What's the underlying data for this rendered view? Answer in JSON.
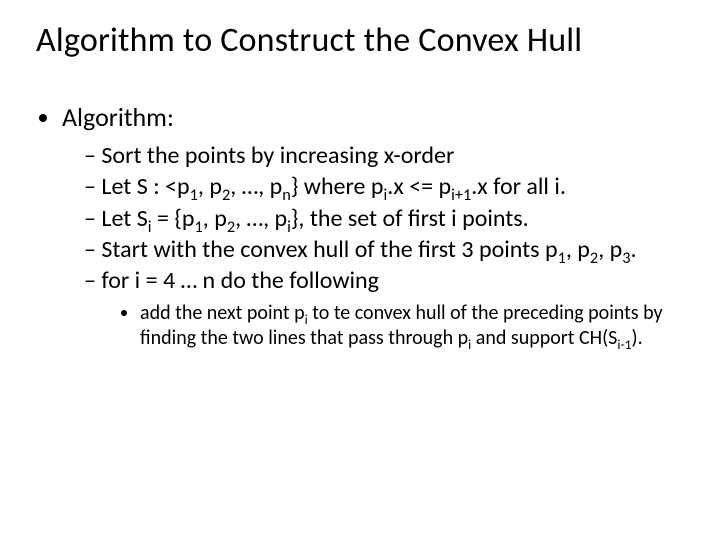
{
  "title": "Algorithm to Construct the Convex Hull",
  "bullets": {
    "lvl1": "Algorithm:",
    "lvl2": [
      {
        "parts": [
          "Sort the points by increasing x-order"
        ]
      },
      {
        "parts": [
          "Let S : <p",
          {
            "sub": "1"
          },
          ", p",
          {
            "sub": "2"
          },
          ", …, p",
          {
            "sub": "n"
          },
          "} where p",
          {
            "sub": "i"
          },
          ".x <= p",
          {
            "sub": "i+1"
          },
          ".x for all i."
        ]
      },
      {
        "parts": [
          "Let S",
          {
            "sub": "i"
          },
          " = {p",
          {
            "sub": "1"
          },
          ", p",
          {
            "sub": "2"
          },
          ", …, p",
          {
            "sub": "i"
          },
          "}, the set of first i points."
        ]
      },
      {
        "parts": [
          "Start with the convex hull of the first 3 points p",
          {
            "sub": "1"
          },
          ", p",
          {
            "sub": "2"
          },
          ", p",
          {
            "sub": "3"
          },
          "."
        ]
      },
      {
        "parts": [
          "for i = 4 … n do the following"
        ],
        "lvl3": [
          {
            "parts": [
              "add the next point p",
              {
                "sub": "i"
              },
              " to te convex hull of the preceding points by finding the two lines that pass through p",
              {
                "sub": "i"
              },
              " and support CH(S",
              {
                "sub": "i-1"
              },
              ")."
            ]
          }
        ]
      }
    ]
  }
}
